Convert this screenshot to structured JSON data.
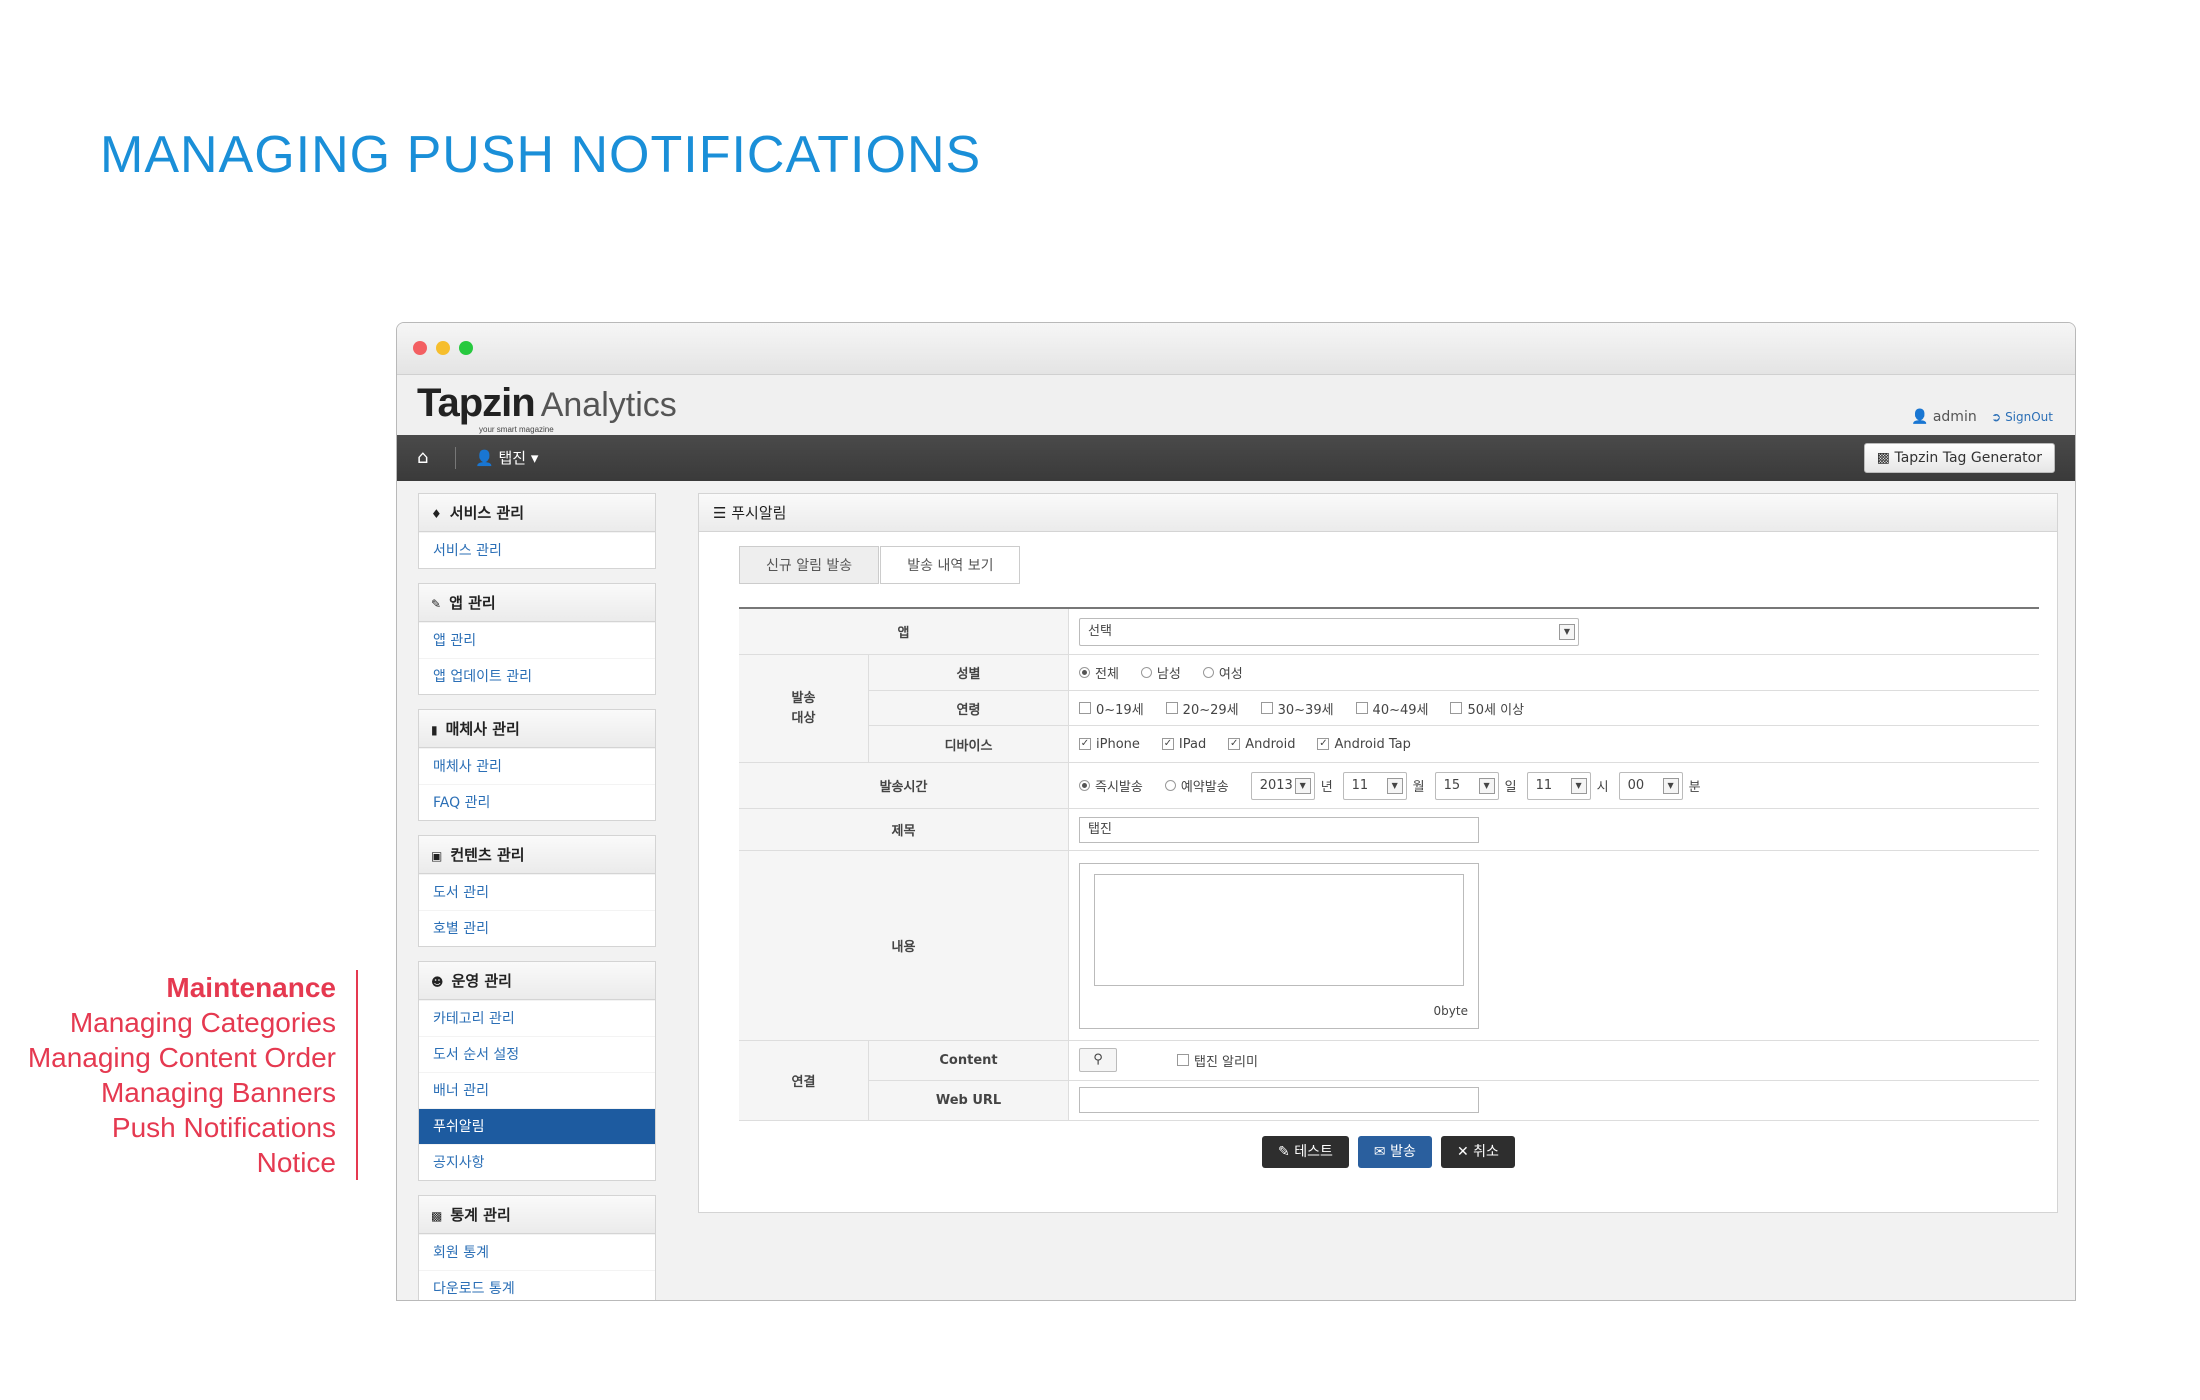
{
  "page_title": "MANAGING PUSH NOTIFICATIONS",
  "annotation": {
    "heading": "Maintenance",
    "items": [
      "Managing Categories",
      "Managing Content Order",
      "Managing Banners",
      "Push Notifications",
      "Notice"
    ]
  },
  "app": {
    "brand": "Tapzin",
    "brand_tagline": "your smart magazine",
    "product": "Analytics",
    "user": "admin",
    "signout": "SignOut",
    "nav_user": "탭진",
    "tag_generator": "Tapzin Tag Generator"
  },
  "sidebar": [
    {
      "title": "서비스 관리",
      "icon": "tag-icon",
      "items": [
        "서비스 관리"
      ]
    },
    {
      "title": "앱 관리",
      "icon": "paperclip-icon",
      "items": [
        "앱 관리",
        "앱 업데이트 관리"
      ]
    },
    {
      "title": "매체사 관리",
      "icon": "book-icon",
      "items": [
        "매체사 관리",
        "FAQ 관리"
      ]
    },
    {
      "title": "컨텐츠 관리",
      "icon": "inbox-icon",
      "items": [
        "도서 관리",
        "호별 관리"
      ]
    },
    {
      "title": "운영 관리",
      "icon": "group-icon",
      "items": [
        "카테고리 관리",
        "도서 순서 설정",
        "배너 관리",
        "푸쉬알림",
        "공지사항"
      ],
      "active": "푸쉬알림"
    },
    {
      "title": "통계 관리",
      "icon": "chart-icon",
      "items": [
        "회원 통계",
        "다운로드 통계"
      ]
    }
  ],
  "content": {
    "title": "푸시알림",
    "tabs": [
      "신규 알림 발송",
      "발송 내역 보기"
    ],
    "app_label": "앱",
    "app_select": "선택",
    "target_label": "발송\n대상",
    "gender_label": "성별",
    "gender_options": [
      "전체",
      "남성",
      "여성"
    ],
    "age_label": "연령",
    "age_options": [
      "0~19세",
      "20~29세",
      "30~39세",
      "40~49세",
      "50세 이상"
    ],
    "device_label": "디바이스",
    "device_options": [
      "iPhone",
      "IPad",
      "Android",
      "Android Tap"
    ],
    "time_label": "발송시간",
    "time_options": [
      "즉시발송",
      "예약발송"
    ],
    "year": "2013",
    "year_unit": "년",
    "month": "11",
    "month_unit": "월",
    "day": "15",
    "day_unit": "일",
    "hour": "11",
    "hour_unit": "시",
    "minute": "00",
    "minute_unit": "분",
    "subject_label": "제목",
    "subject_value": "탭진",
    "body_label": "내용",
    "byte_count": "0byte",
    "link_label": "연결",
    "content_label": "Content",
    "tapzin_notice": "탭진 알리미",
    "weburl_label": "Web URL",
    "buttons": {
      "test": "테스트",
      "send": "발송",
      "cancel": "취소"
    }
  }
}
